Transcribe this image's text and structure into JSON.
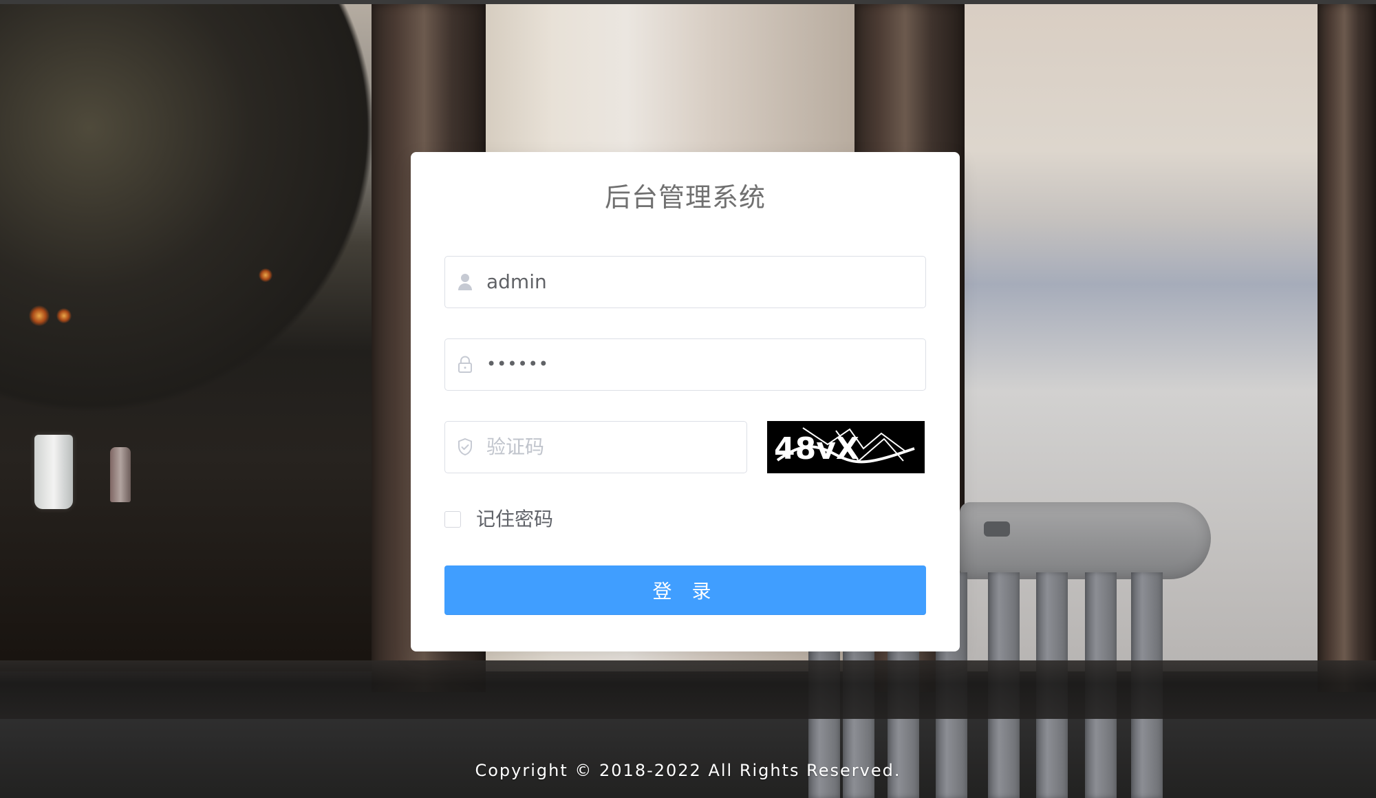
{
  "app": {
    "title": "后台管理系统"
  },
  "login_form": {
    "username_value": "admin",
    "password_display": "••••••",
    "captcha_placeholder": "验证码",
    "captcha_image_text": "48vX",
    "remember_label": "记住密码",
    "login_button_label": "登 录"
  },
  "footer": {
    "copyright": "Copyright © 2018-2022 All Rights Reserved."
  },
  "icons": {
    "username": "user-icon",
    "password": "lock-icon",
    "captcha": "shield-check-icon"
  },
  "colors": {
    "primary": "#409eff",
    "border": "#dcdfe6",
    "placeholder": "#c0c4cc",
    "text": "#606266"
  }
}
